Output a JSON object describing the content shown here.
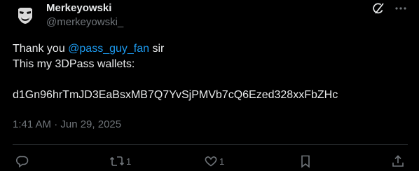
{
  "author": {
    "display_name": "Merkeyowski",
    "handle": "@merkeyowski_"
  },
  "post": {
    "line1_prefix": "Thank you ",
    "line1_mention": "@pass_guy_fan",
    "line1_suffix": " sir",
    "line2": "This my 3DPass wallets:",
    "line4": "d1Gn96hrTmJD3EaBsxMB7Q7YvSjPMVb7cQ6Ezed328xxFbZHc",
    "timestamp": "1:41 AM · Jun 29, 2025"
  },
  "actions": {
    "reply_icon": "reply-icon",
    "repost_icon": "repost-icon",
    "repost_count": "1",
    "like_icon": "heart-icon",
    "like_count": "1",
    "bookmark_icon": "bookmark-icon",
    "share_icon": "share-icon"
  },
  "top_icons": [
    "grok-icon",
    "more-icon"
  ],
  "colors": {
    "background": "#000000",
    "text": "#e7e9ea",
    "muted": "#71767b",
    "link": "#1d9bf0",
    "divider": "#2f3336"
  }
}
